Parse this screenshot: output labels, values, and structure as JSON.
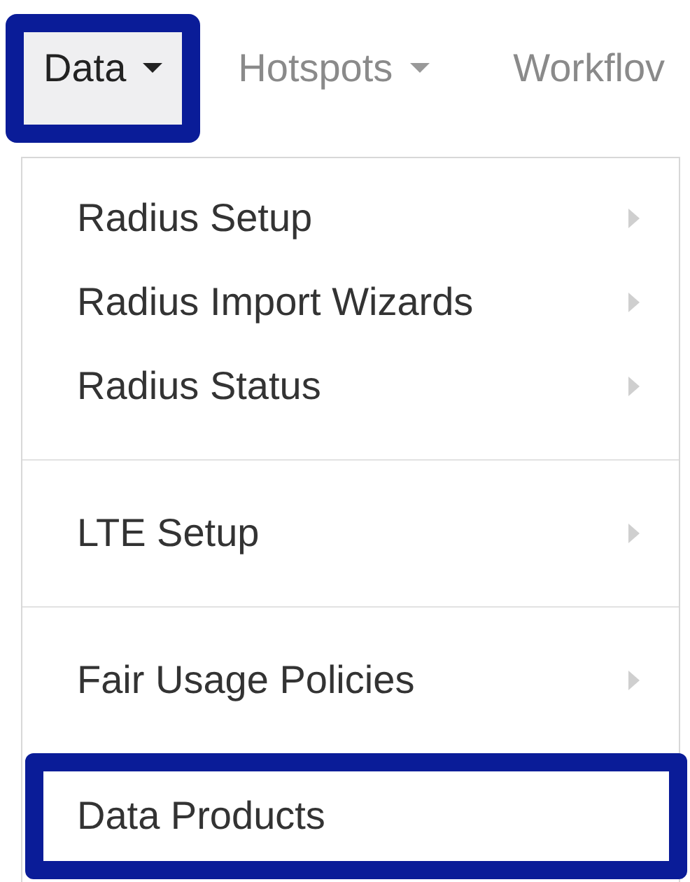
{
  "navbar": {
    "items": [
      {
        "label": "Data",
        "has_menu": true,
        "selected": true,
        "highlighted": true
      },
      {
        "label": "Hotspots",
        "has_menu": true,
        "selected": false,
        "highlighted": false
      },
      {
        "label": "Workflov",
        "has_menu": false,
        "selected": false,
        "highlighted": false
      }
    ]
  },
  "dropdown": {
    "items": [
      {
        "kind": "submenu",
        "label": "Radius Setup",
        "highlighted": false
      },
      {
        "kind": "submenu",
        "label": "Radius Import Wizards",
        "highlighted": false
      },
      {
        "kind": "submenu",
        "label": "Radius Status",
        "highlighted": false
      },
      {
        "kind": "divider"
      },
      {
        "kind": "submenu",
        "label": "LTE Setup",
        "highlighted": false
      },
      {
        "kind": "divider"
      },
      {
        "kind": "submenu",
        "label": "Fair Usage Policies",
        "highlighted": false
      },
      {
        "kind": "link",
        "label": "Data Products",
        "highlighted": true
      }
    ]
  }
}
